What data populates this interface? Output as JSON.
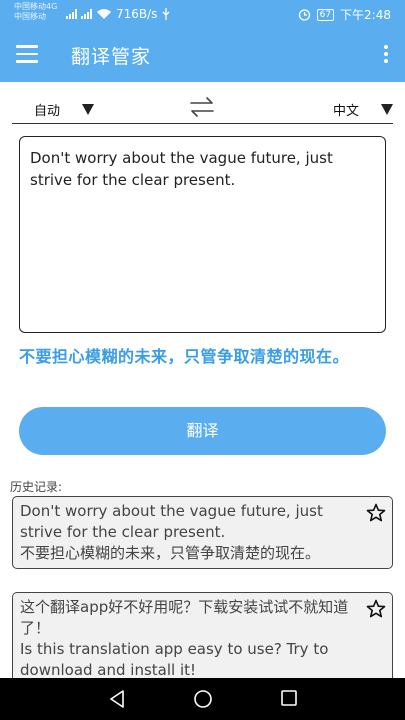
{
  "status_bar": {
    "carrier_1": "中国移动4G",
    "carrier_2": "中国移动",
    "speed": "716B/s",
    "battery": "67",
    "time": "下午2:48"
  },
  "app_bar": {
    "title": "翻译管家"
  },
  "languages": {
    "source": "自动",
    "target": "中文"
  },
  "input": {
    "text": "Don't worry about the vague future, just strive for the clear present."
  },
  "result": {
    "text": "不要担心模糊的未来，只管争取清楚的现在。"
  },
  "translate_button": {
    "label": "翻译"
  },
  "history": {
    "label": "历史记录:",
    "items": [
      {
        "source": "Don't worry about the vague future, just strive for the clear present.",
        "translation": "不要担心模糊的未来，只管争取清楚的现在。"
      },
      {
        "source": "这个翻译app好不好用呢？下载安装试试不就知道了！",
        "translation": "Is this translation app easy to use? Try to download and install it!"
      }
    ]
  },
  "colors": {
    "primary": "#5aaef0",
    "result_text": "#3a9de8",
    "nav_bar": "#000000"
  },
  "icons": {
    "menu": "hamburger-menu-icon",
    "more": "more-vertical-icon",
    "swap": "swap-arrows-icon",
    "dropdown": "triangle-down-icon",
    "favorite": "star-outline-icon",
    "nav_back": "triangle-back-icon",
    "nav_home": "circle-home-icon",
    "nav_recent": "square-recent-icon"
  }
}
